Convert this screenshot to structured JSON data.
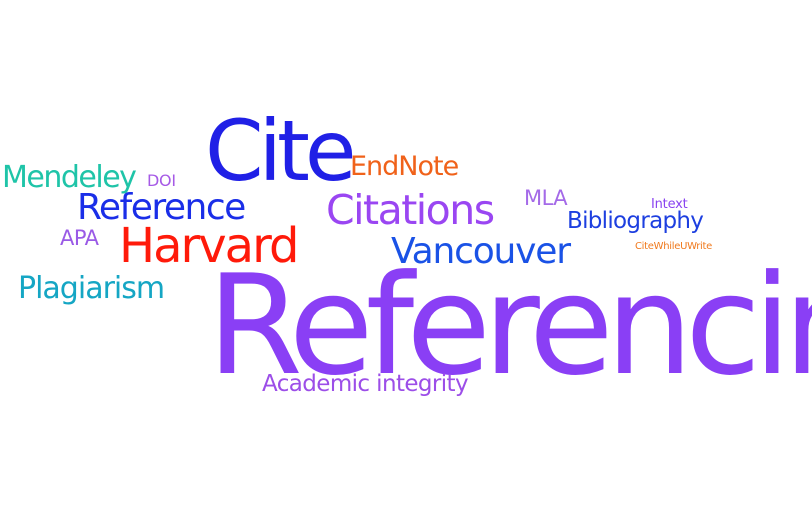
{
  "word_cloud": {
    "words": [
      {
        "text": "Referencing",
        "color": "#8a3ff5"
      },
      {
        "text": "Cite",
        "color": "#2020e6"
      },
      {
        "text": "Harvard",
        "color": "#ff1a0a"
      },
      {
        "text": "Citations",
        "color": "#9a46f2"
      },
      {
        "text": "Reference",
        "color": "#1a2ee8"
      },
      {
        "text": "Vancouver",
        "color": "#1a52e6"
      },
      {
        "text": "Mendeley",
        "color": "#1fc4a8"
      },
      {
        "text": "Plagiarism",
        "color": "#15a6c4"
      },
      {
        "text": "EndNote",
        "color": "#f0621a"
      },
      {
        "text": "Academic integrity",
        "color": "#9c4ee8"
      },
      {
        "text": "Bibliography",
        "color": "#1d3fe0"
      },
      {
        "text": "APA",
        "color": "#9a5ae6"
      },
      {
        "text": "MLA",
        "color": "#a46ae8"
      },
      {
        "text": "DOI",
        "color": "#a65ae6"
      },
      {
        "text": "Intext",
        "color": "#8a44f0"
      },
      {
        "text": "CiteWhileUWrite",
        "color": "#f07a1e"
      }
    ]
  }
}
